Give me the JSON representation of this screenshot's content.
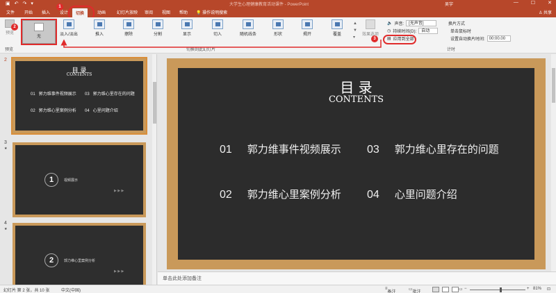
{
  "window": {
    "doc_title": "大学生心理健康教育活动课件 - PowerPoint",
    "user": "吴宇",
    "controls": [
      "—",
      "☐",
      "✕"
    ]
  },
  "tabs": [
    {
      "label": "文件"
    },
    {
      "label": "开始"
    },
    {
      "label": "插入"
    },
    {
      "label": "设计"
    },
    {
      "label": "切换"
    },
    {
      "label": "动画"
    },
    {
      "label": "幻灯片放映"
    },
    {
      "label": "审阅"
    },
    {
      "label": "视图"
    },
    {
      "label": "帮助"
    }
  ],
  "tell_me": "操作说明搜索",
  "share": "共享",
  "ribbon": {
    "preview_label": "预览",
    "preview_group": "预览",
    "transitions": [
      {
        "label": "无"
      },
      {
        "label": "淡入/淡出"
      },
      {
        "label": "推入"
      },
      {
        "label": "擦除"
      },
      {
        "label": "分割"
      },
      {
        "label": "显示"
      },
      {
        "label": "切入"
      },
      {
        "label": "随机线条"
      },
      {
        "label": "形状"
      },
      {
        "label": "揭开"
      },
      {
        "label": "覆盖"
      }
    ],
    "transitions_group": "切换到此幻灯片",
    "effect_options": "效果选项",
    "timing": {
      "sound_label": "声音:",
      "sound_value": "[无声音]",
      "duration_label": "持续时间(D):",
      "duration_value": "自动",
      "apply_all": "应用到全部"
    },
    "switch_mode": {
      "title": "换片方式",
      "on_click": "单击鼠标时",
      "on_click_checked": true,
      "after": "设置自动换片时间:",
      "after_value": "00:00.00",
      "after_checked": false
    },
    "timing_group": "计时"
  },
  "badges": {
    "one": "1",
    "two": "2",
    "three": "3"
  },
  "slides": [
    {
      "number": "2",
      "title": "目 录",
      "subtitle": "CONTENTS",
      "items": [
        {
          "num": "01",
          "text": "郭力维事件视频展示"
        },
        {
          "num": "03",
          "text": "郭力维心里存在的问题"
        },
        {
          "num": "02",
          "text": "郭力维心里案例分析"
        },
        {
          "num": "04",
          "text": "心里问题介绍"
        }
      ]
    },
    {
      "number": "3",
      "star": "★",
      "circle": "1",
      "label": "视频展示",
      "arrows": "▶ ▶ ▶"
    },
    {
      "number": "4",
      "star": "★",
      "circle": "2",
      "label": "郭力维心里案例分析",
      "arrows": "▶ ▶ ▶"
    }
  ],
  "notes_placeholder": "单击此处添加备注",
  "status": {
    "slide_info": "幻灯片 第 2 张，共 10 张",
    "language": "中文(中国)",
    "notes": "备注",
    "comments": "批注",
    "zoom": "81%",
    "zoom_fraction": 0.55
  }
}
